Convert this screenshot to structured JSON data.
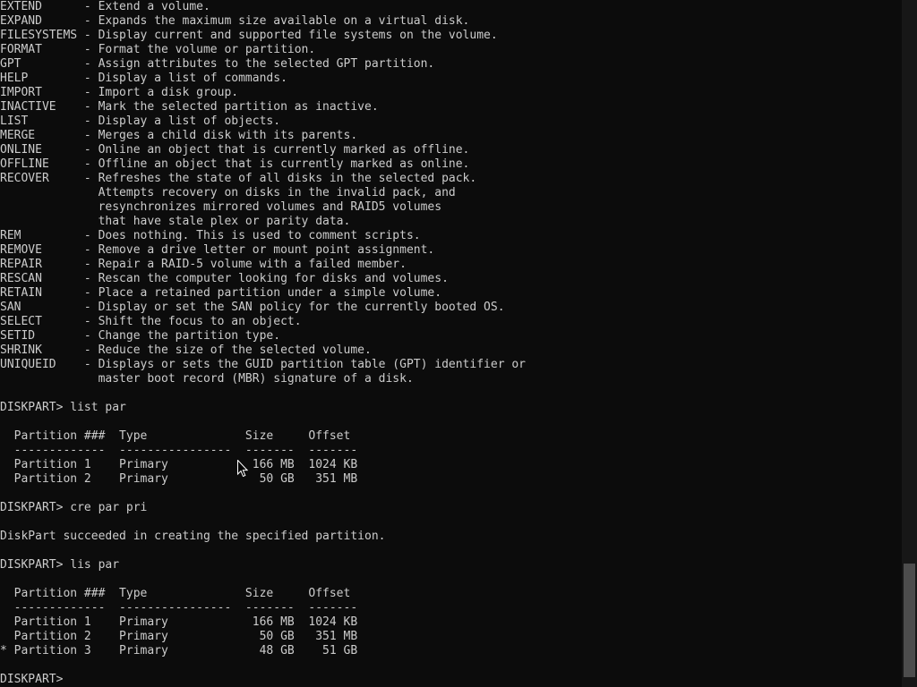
{
  "console": {
    "foreground": "#cccccc",
    "background": "#0c0c0c",
    "lines": [
      "EXTEND      - Extend a volume.",
      "EXPAND      - Expands the maximum size available on a virtual disk.",
      "FILESYSTEMS - Display current and supported file systems on the volume.",
      "FORMAT      - Format the volume or partition.",
      "GPT         - Assign attributes to the selected GPT partition.",
      "HELP        - Display a list of commands.",
      "IMPORT      - Import a disk group.",
      "INACTIVE    - Mark the selected partition as inactive.",
      "LIST        - Display a list of objects.",
      "MERGE       - Merges a child disk with its parents.",
      "ONLINE      - Online an object that is currently marked as offline.",
      "OFFLINE     - Offline an object that is currently marked as online.",
      "RECOVER     - Refreshes the state of all disks in the selected pack.",
      "              Attempts recovery on disks in the invalid pack, and",
      "              resynchronizes mirrored volumes and RAID5 volumes",
      "              that have stale plex or parity data.",
      "REM         - Does nothing. This is used to comment scripts.",
      "REMOVE      - Remove a drive letter or mount point assignment.",
      "REPAIR      - Repair a RAID-5 volume with a failed member.",
      "RESCAN      - Rescan the computer looking for disks and volumes.",
      "RETAIN      - Place a retained partition under a simple volume.",
      "SAN         - Display or set the SAN policy for the currently booted OS.",
      "SELECT      - Shift the focus to an object.",
      "SETID       - Change the partition type.",
      "SHRINK      - Reduce the size of the selected volume.",
      "UNIQUEID    - Displays or sets the GUID partition table (GPT) identifier or",
      "              master boot record (MBR) signature of a disk.",
      "",
      "DISKPART> list par",
      "",
      "  Partition ###  Type              Size     Offset",
      "  -------------  ----------------  -------  -------",
      "  Partition 1    Primary            166 MB  1024 KB",
      "  Partition 2    Primary             50 GB   351 MB",
      "",
      "DISKPART> cre par pri",
      "",
      "DiskPart succeeded in creating the specified partition.",
      "",
      "DISKPART> lis par",
      "",
      "  Partition ###  Type              Size     Offset",
      "  -------------  ----------------  -------  -------",
      "  Partition 1    Primary            166 MB  1024 KB",
      "  Partition 2    Primary             50 GB   351 MB",
      "* Partition 3    Primary             48 GB    51 GB",
      "",
      "DISKPART> "
    ]
  },
  "scrollbar": {
    "track_color": "#171717",
    "thumb_color": "#4d4d4d",
    "thumb_start_fraction": 0.82,
    "thumb_end_fraction": 0.985
  },
  "cursor": {
    "icon": "mouse-pointer-icon"
  }
}
